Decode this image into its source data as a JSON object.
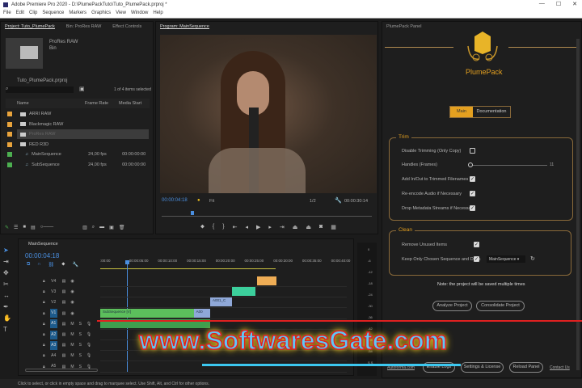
{
  "window": {
    "title": "Adobe Premiere Pro 2020 - D:\\PlumePackTuto\\Tuto_PlumePack.prproj *",
    "controls": [
      "—",
      "☐",
      "✕"
    ]
  },
  "menu": [
    "File",
    "Edit",
    "Clip",
    "Sequence",
    "Markers",
    "Graphics",
    "View",
    "Window",
    "Help"
  ],
  "project": {
    "tabs": [
      "Project: Tuto_PlumePack",
      "Bin: ProRes RAW",
      "Effect Controls"
    ],
    "preview_name": "ProRes RAW",
    "preview_type": "Bin",
    "path": "Tuto_PlumePack.prproj",
    "selection_info": "1 of 4 items selected",
    "columns": [
      "Name",
      "Frame Rate",
      "Media Start"
    ],
    "items": [
      {
        "name": "ARRI RAW",
        "rate": "",
        "start": "",
        "color": "#e8a33c",
        "type": "folder"
      },
      {
        "name": "Blackmagic RAW",
        "rate": "",
        "start": "",
        "color": "#e8a33c",
        "type": "folder"
      },
      {
        "name": "ProRes RAW",
        "rate": "",
        "start": "",
        "color": "#e8a33c",
        "type": "folder"
      },
      {
        "name": "RED R3D",
        "rate": "",
        "start": "",
        "color": "#e8a33c",
        "type": "folder"
      },
      {
        "name": "MainSequence",
        "rate": "24,00 fps",
        "start": "00:00:00:00",
        "color": "#4caf50",
        "type": "sequence"
      },
      {
        "name": "SubSequence",
        "rate": "24,00 fps",
        "start": "00:00:00:00",
        "color": "#4caf50",
        "type": "sequence"
      }
    ]
  },
  "program": {
    "tab": "Program: MainSequence",
    "timecode": "00:00:04:18",
    "fit": "Fit",
    "resolution": "1/2",
    "duration": "00:00:30:14",
    "playhead_fraction": 0.15
  },
  "timeline": {
    "tab": "MainSequence",
    "timecode": "00:00:04:18",
    "ruler": [
      ":00:00",
      "00:00:05:00",
      "00:00:10:00",
      "00:00:15:00",
      "00:00:20:00",
      "00:00:25:00",
      "00:00:30:00",
      "00:00:35:00",
      "00:00:40:00"
    ],
    "video_tracks": [
      "V4",
      "V3",
      "V2",
      "V1"
    ],
    "audio_tracks": [
      "A1",
      "A2",
      "A3",
      "A4",
      "A5"
    ],
    "clips": [
      {
        "label": "SubSequence [V]",
        "track": "V1",
        "start": 0,
        "end": 17,
        "color": "#5cbf5c"
      },
      {
        "label": "A00",
        "track": "V1",
        "start": 17,
        "end": 20,
        "color": "#8fa8d8"
      },
      {
        "label": "A001_C",
        "track": "V2",
        "start": 20,
        "end": 24,
        "color": "#8fa8d8"
      },
      {
        "label": "",
        "track": "V3",
        "start": 24,
        "end": 28.3,
        "color": "#3ccf9c"
      },
      {
        "label": "",
        "track": "V4",
        "start": 28.5,
        "end": 32,
        "color": "#efad55"
      },
      {
        "label": "",
        "track": "A1",
        "start": 0,
        "end": 20,
        "color": "#3f9f4f"
      }
    ],
    "meter_labels": [
      "0",
      "-6",
      "-12",
      "-18",
      "-24",
      "-30",
      "-36",
      "-42",
      "-48",
      "-54",
      "S S"
    ]
  },
  "plumepack": {
    "panel_tab": "PlumePack Panel",
    "title": "PlumePack",
    "tabs": [
      "Main",
      "Documentation"
    ],
    "trim": {
      "legend": "Trim",
      "options": [
        {
          "label": "Disable Trimming (Only Copy)",
          "checked": false
        },
        {
          "label": "Add In/Out to Trimmed Filenames",
          "checked": true
        },
        {
          "label": "Re-encode Audio if Necessary",
          "checked": true
        },
        {
          "label": "Drop Metadata Streams if Necessary",
          "checked": true
        }
      ],
      "handles_label": "Handles (Frames)",
      "handles_value": "11"
    },
    "clean": {
      "legend": "Clean",
      "remove_label": "Remove Unused Items",
      "keep_label": "Keep Only Chosen Sequence and Deps",
      "sequence": "MainSequence"
    },
    "note": "Note: the project will be saved multiple times",
    "analyze": "Analyze Project",
    "consolidate": "Consolidate Project",
    "footer": {
      "link": "Autoforma.com",
      "logs": "Enable Logs",
      "settings": "Settings & License",
      "reload": "Reload Panel",
      "contact": "Contact Us"
    }
  },
  "status": "Click to select, or click in empty space and drag to marquee select. Use Shift, Alt, and Ctrl for other options.",
  "watermark": "www.SoftwaresGate.com",
  "colors": {
    "accent": "#e4a020",
    "timecode": "#4a8fe0"
  }
}
